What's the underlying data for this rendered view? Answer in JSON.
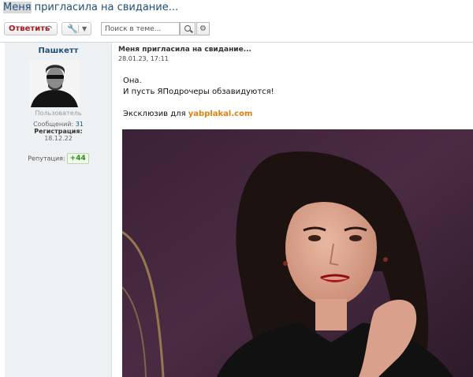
{
  "topic": {
    "title_highlight": "Меня",
    "title_rest": " пригласила на свидание..."
  },
  "toolbar": {
    "reply_label": "Ответить",
    "search_placeholder": "Поиск в теме..."
  },
  "author": {
    "username": "Пашкетт",
    "role": "Пользователь",
    "messages_label": "Сообщений:",
    "messages_count": "31",
    "registration_label": "Регистрация:",
    "registration_date": "18.12.22",
    "reputation_label": "Репутация:",
    "reputation_value": "+44"
  },
  "post": {
    "title": "Меня пригласила на свидание...",
    "date": "28.01.23, 17:11",
    "line1": "Она.",
    "line2": "И пусть ЯПодрочеры обзавидуются!",
    "exclusive_prefix": "Эксклюзив для ",
    "exclusive_link": "yabplakal.com"
  },
  "colors": {
    "accent": "#1d4f7c",
    "reply": "#b0171f",
    "link": "#e87f0a",
    "reputation": "#2f8a1c"
  },
  "icons": {
    "reply": "reply-arrow-icon",
    "tools": "wrench-icon",
    "dropdown": "chevron-down-icon",
    "search": "search-icon",
    "settings": "gear-icon"
  }
}
